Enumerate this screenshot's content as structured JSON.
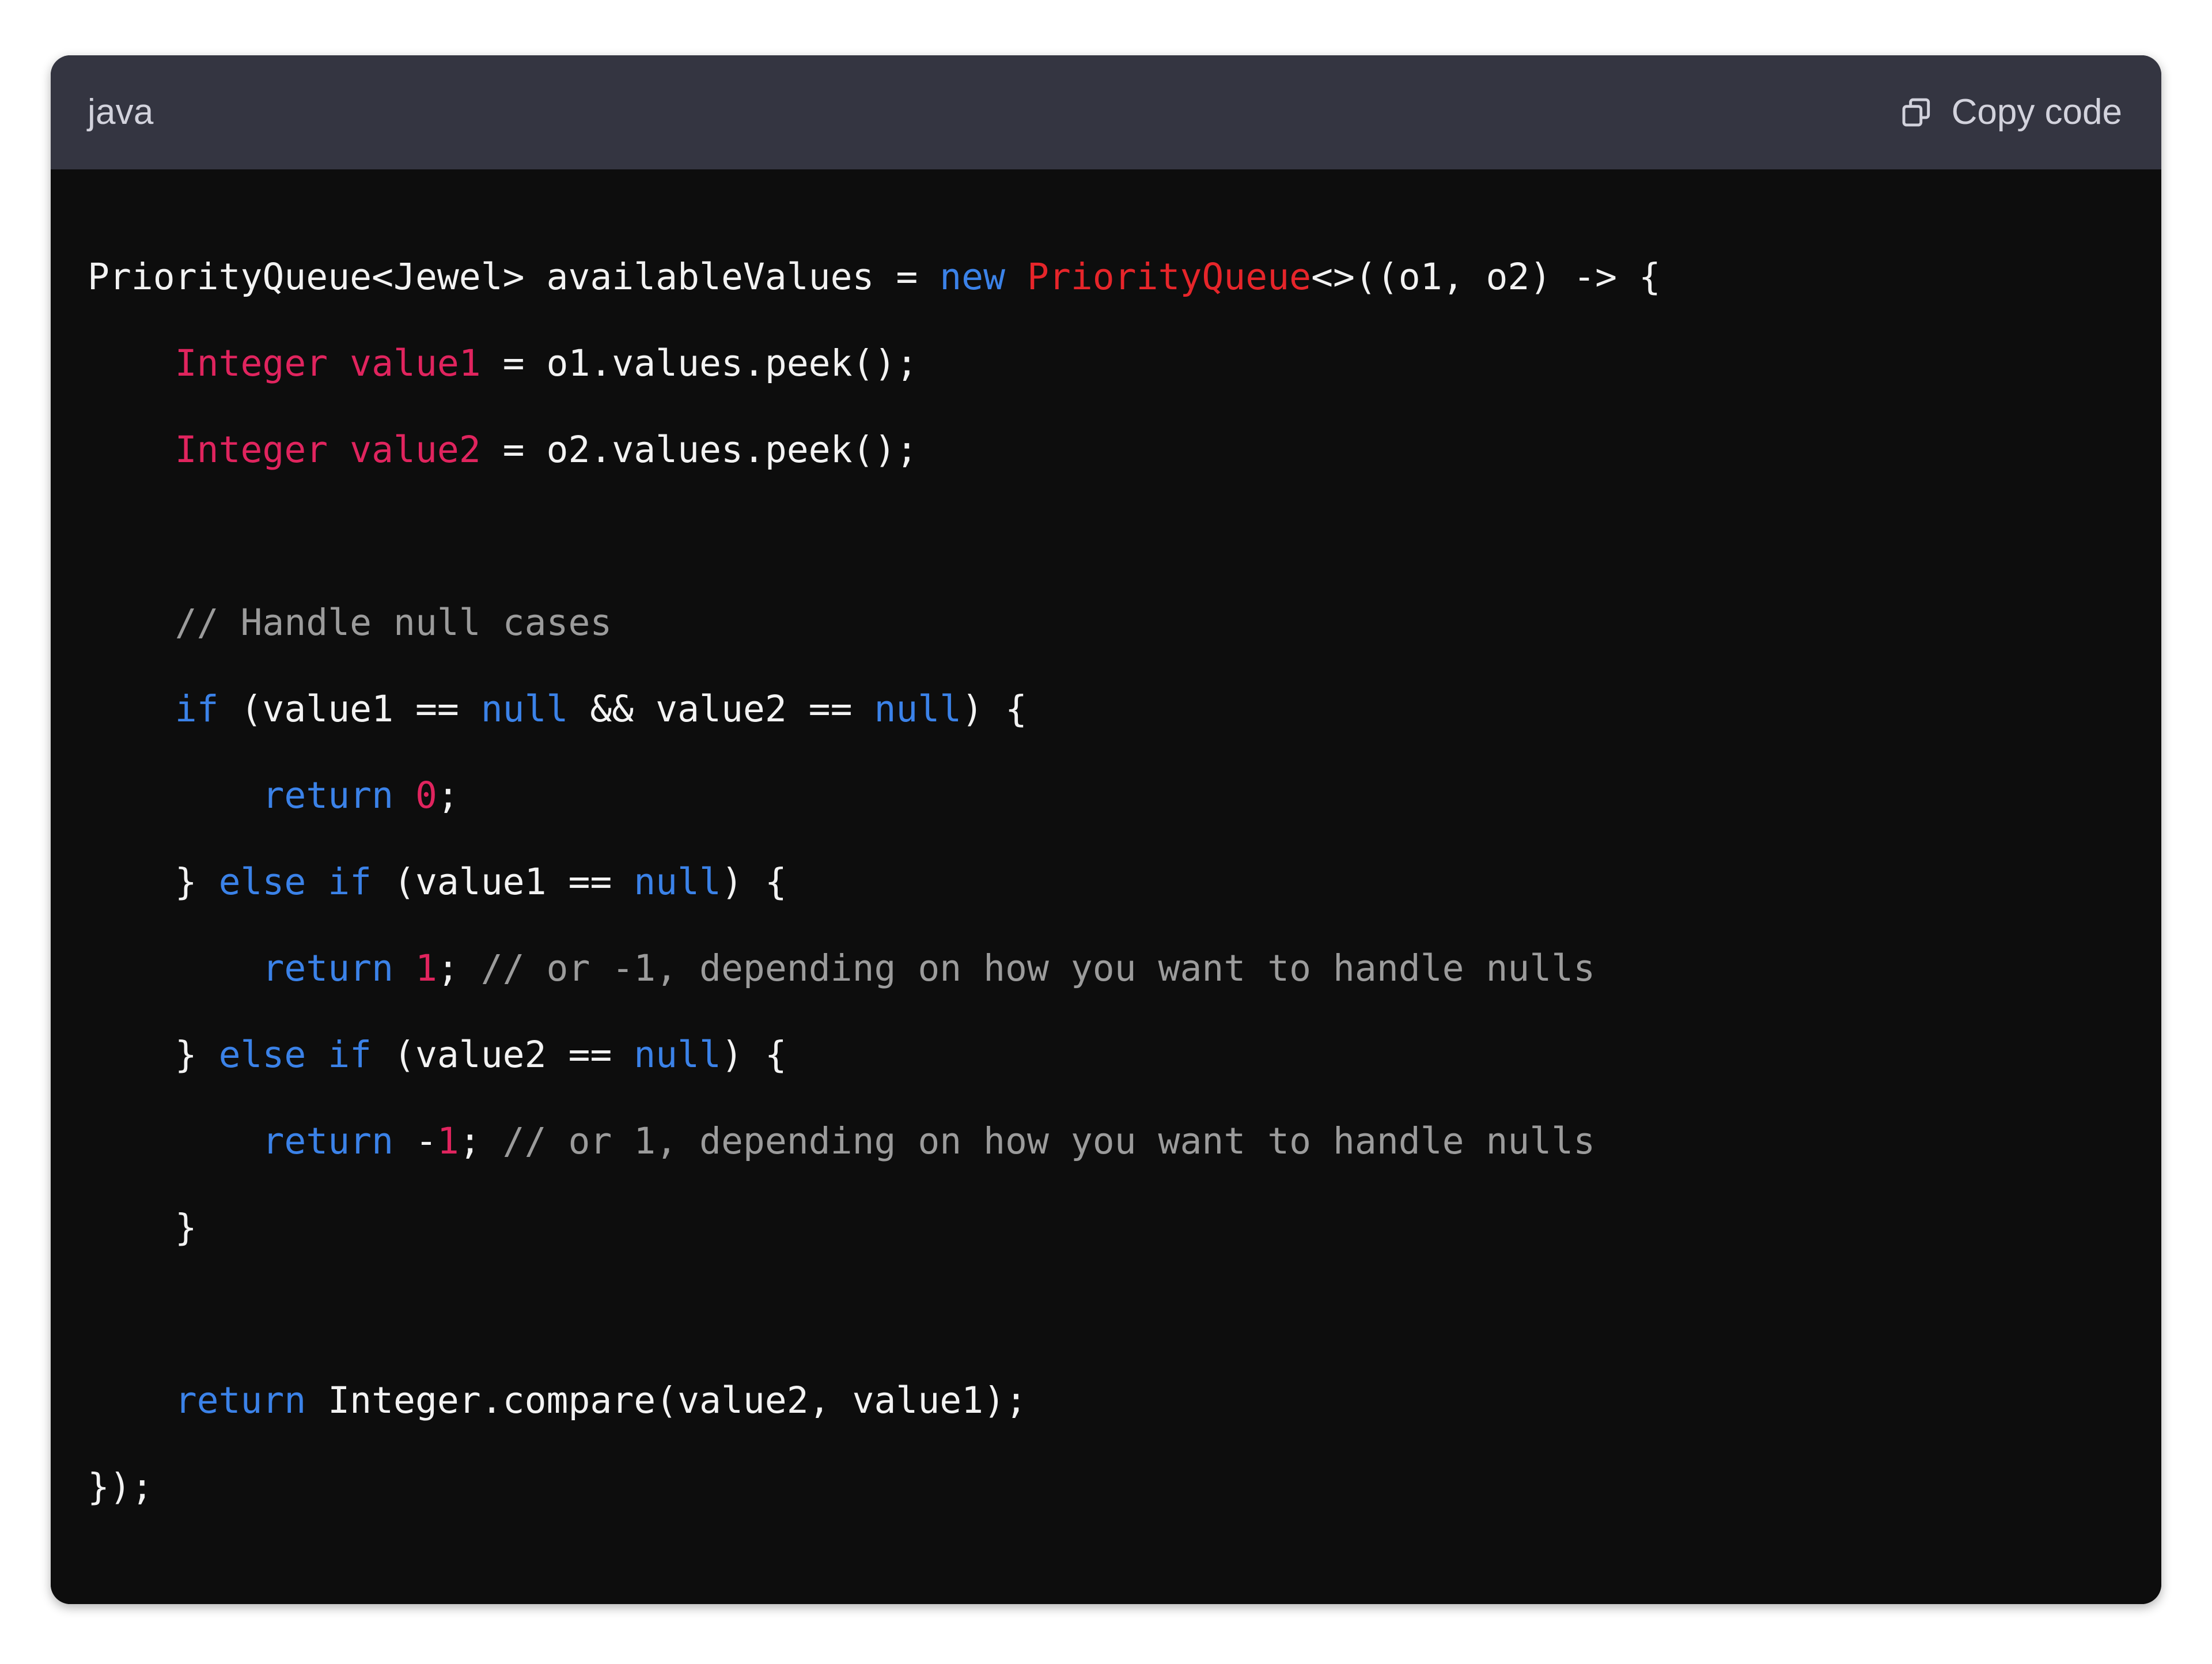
{
  "page": {
    "background": "#ffffff"
  },
  "codeblock": {
    "language_label": "java",
    "copy_button": {
      "label": "Copy code",
      "icon": "copy-icon"
    },
    "colors": {
      "header_background": "#343541",
      "body_background": "#0d0d0d",
      "default_text": "#f2f2f2",
      "keyword": "#3b82e8",
      "type": "#e0245e",
      "class_name": "#e6252a",
      "number": "#e0245e",
      "comment": "#9b9b9b",
      "header_text": "#d2d2dc"
    },
    "code_lines": [
      {
        "id": 1,
        "tokens": [
          {
            "t": "PriorityQueue<Jewel> availableValues = ",
            "c": "plain"
          },
          {
            "t": "new ",
            "c": "kw"
          },
          {
            "t": "PriorityQueue",
            "c": "class"
          },
          {
            "t": "<>((o1, o2) -> {",
            "c": "plain"
          }
        ]
      },
      {
        "id": 2,
        "tokens": [
          {
            "t": "    ",
            "c": "plain"
          },
          {
            "t": "Integer value1",
            "c": "type"
          },
          {
            "t": " = o1.values.peek();",
            "c": "plain"
          }
        ]
      },
      {
        "id": 3,
        "tokens": [
          {
            "t": "    ",
            "c": "plain"
          },
          {
            "t": "Integer value2",
            "c": "type"
          },
          {
            "t": " = o2.values.peek();",
            "c": "plain"
          }
        ]
      },
      {
        "id": 4,
        "tokens": [
          {
            "t": "",
            "c": "plain"
          }
        ]
      },
      {
        "id": 5,
        "tokens": [
          {
            "t": "    ",
            "c": "plain"
          },
          {
            "t": "// Handle null cases",
            "c": "comment"
          }
        ]
      },
      {
        "id": 6,
        "tokens": [
          {
            "t": "    ",
            "c": "plain"
          },
          {
            "t": "if",
            "c": "kw"
          },
          {
            "t": " (value1 == ",
            "c": "plain"
          },
          {
            "t": "null",
            "c": "kw"
          },
          {
            "t": " && value2 == ",
            "c": "plain"
          },
          {
            "t": "null",
            "c": "kw"
          },
          {
            "t": ") {",
            "c": "plain"
          }
        ]
      },
      {
        "id": 7,
        "tokens": [
          {
            "t": "        ",
            "c": "plain"
          },
          {
            "t": "return",
            "c": "kw"
          },
          {
            "t": " ",
            "c": "plain"
          },
          {
            "t": "0",
            "c": "num"
          },
          {
            "t": ";",
            "c": "plain"
          }
        ]
      },
      {
        "id": 8,
        "tokens": [
          {
            "t": "    } ",
            "c": "plain"
          },
          {
            "t": "else if",
            "c": "kw"
          },
          {
            "t": " (value1 == ",
            "c": "plain"
          },
          {
            "t": "null",
            "c": "kw"
          },
          {
            "t": ") {",
            "c": "plain"
          }
        ]
      },
      {
        "id": 9,
        "tokens": [
          {
            "t": "        ",
            "c": "plain"
          },
          {
            "t": "return",
            "c": "kw"
          },
          {
            "t": " ",
            "c": "plain"
          },
          {
            "t": "1",
            "c": "num"
          },
          {
            "t": "; ",
            "c": "plain"
          },
          {
            "t": "// or -1, depending on how you want to handle nulls",
            "c": "comment"
          }
        ]
      },
      {
        "id": 10,
        "tokens": [
          {
            "t": "    } ",
            "c": "plain"
          },
          {
            "t": "else if",
            "c": "kw"
          },
          {
            "t": " (value2 == ",
            "c": "plain"
          },
          {
            "t": "null",
            "c": "kw"
          },
          {
            "t": ") {",
            "c": "plain"
          }
        ]
      },
      {
        "id": 11,
        "tokens": [
          {
            "t": "        ",
            "c": "plain"
          },
          {
            "t": "return",
            "c": "kw"
          },
          {
            "t": " -",
            "c": "plain"
          },
          {
            "t": "1",
            "c": "num"
          },
          {
            "t": "; ",
            "c": "plain"
          },
          {
            "t": "// or 1, depending on how you want to handle nulls",
            "c": "comment"
          }
        ]
      },
      {
        "id": 12,
        "tokens": [
          {
            "t": "    }",
            "c": "plain"
          }
        ]
      },
      {
        "id": 13,
        "tokens": [
          {
            "t": "",
            "c": "plain"
          }
        ]
      },
      {
        "id": 14,
        "tokens": [
          {
            "t": "    ",
            "c": "plain"
          },
          {
            "t": "return",
            "c": "kw"
          },
          {
            "t": " Integer.compare(value2, value1);",
            "c": "plain"
          }
        ]
      },
      {
        "id": 15,
        "tokens": [
          {
            "t": "});",
            "c": "plain"
          }
        ]
      }
    ],
    "plain_text": "PriorityQueue<Jewel> availableValues = new PriorityQueue<>((o1, o2) -> {\n    Integer value1 = o1.values.peek();\n    Integer value2 = o2.values.peek();\n\n    // Handle null cases\n    if (value1 == null && value2 == null) {\n        return 0;\n    } else if (value1 == null) {\n        return 1; // or -1, depending on how you want to handle nulls\n    } else if (value2 == null) {\n        return -1; // or 1, depending on how you want to handle nulls\n    }\n\n    return Integer.compare(value2, value1);\n});"
  }
}
